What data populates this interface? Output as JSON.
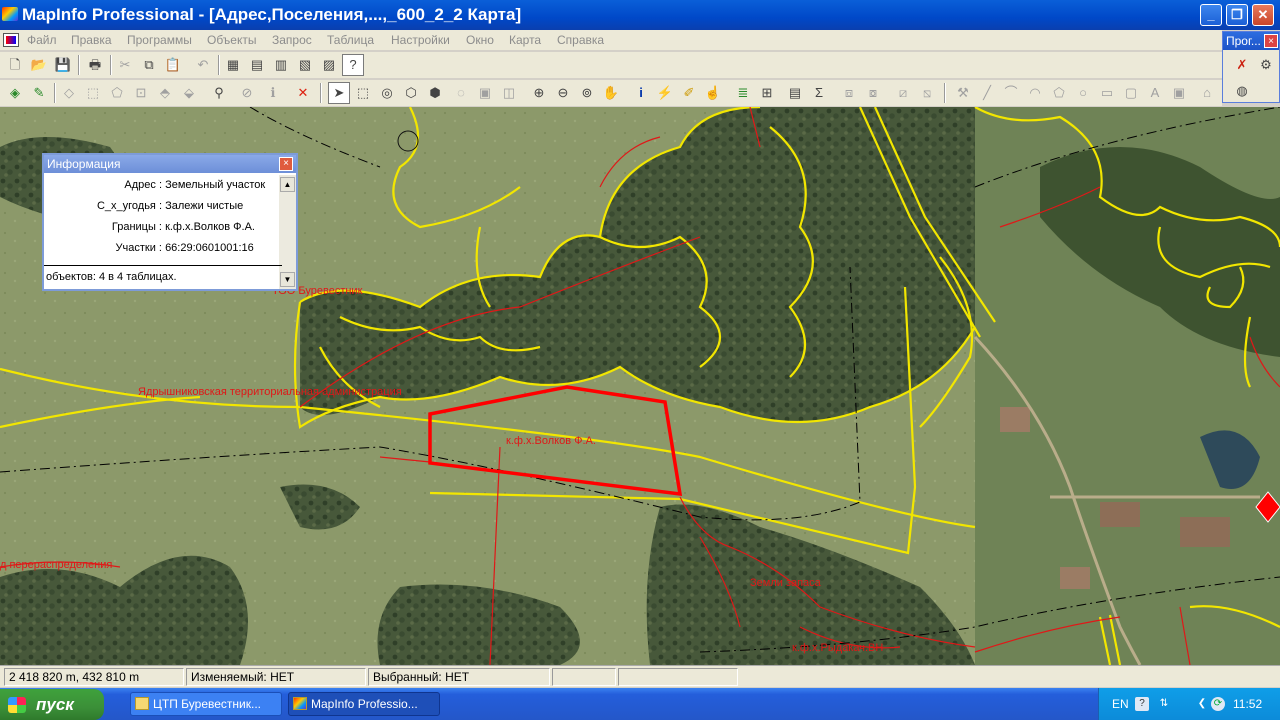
{
  "window": {
    "title": "MapInfo Professional - [Адрес,Поселения,...,_600_2_2 Карта]",
    "min_label": "_",
    "max_label": "❐",
    "close_label": "✕"
  },
  "menu": [
    "Файл",
    "Правка",
    "Программы",
    "Объекты",
    "Запрос",
    "Таблица",
    "Настройки",
    "Окно",
    "Карта",
    "Справка"
  ],
  "programs_window": {
    "title": "Прог...",
    "close_label": "×"
  },
  "info_window": {
    "title": "Информация",
    "close_label": "×",
    "rows": [
      {
        "label": "Адрес :",
        "value": "Земельный участок"
      },
      {
        "label": "С_х_угодья :",
        "value": "Залежи чистые"
      },
      {
        "label": "Границы :",
        "value": "к.ф.х.Волков Ф.А."
      },
      {
        "label": "Участки :",
        "value": "66:29:0601001:16"
      }
    ],
    "footer": "объектов: 4 в 4 таблицах."
  },
  "map": {
    "labels": {
      "too": "ТОО Буревестник",
      "territory": "Ядрышниковская территориальная администрация",
      "parcel": "к.ф.х.Волков Ф.А.",
      "redistribution": "д перераспределения",
      "zemzapas": "Земли запаса",
      "kfx": "к.ф.х.Рыдакач.ВН"
    },
    "colors": {
      "boundary_yellow": "#f2e600",
      "boundary_red": "#e01818",
      "selected": "#ff0000"
    }
  },
  "status": {
    "coords": "2 418 820 m, 432 810 m",
    "editable": "Изменяемый: НЕТ",
    "selected": "Выбранный: НЕТ"
  },
  "taskbar": {
    "start_label": "пуск",
    "tasks": [
      "ЦТП Буревестник...",
      "MapInfo Professio..."
    ],
    "lang": "EN",
    "clock": "11:52"
  },
  "toolbar_icons": [
    "new-icon",
    "open-icon",
    "save-icon",
    "print-icon",
    "cut-icon",
    "copy-icon",
    "paste-icon",
    "undo-icon",
    "new-browser-icon",
    "new-map-icon",
    "new-graph-icon",
    "new-layout-icon",
    "redistrict-icon",
    "help-icon"
  ]
}
